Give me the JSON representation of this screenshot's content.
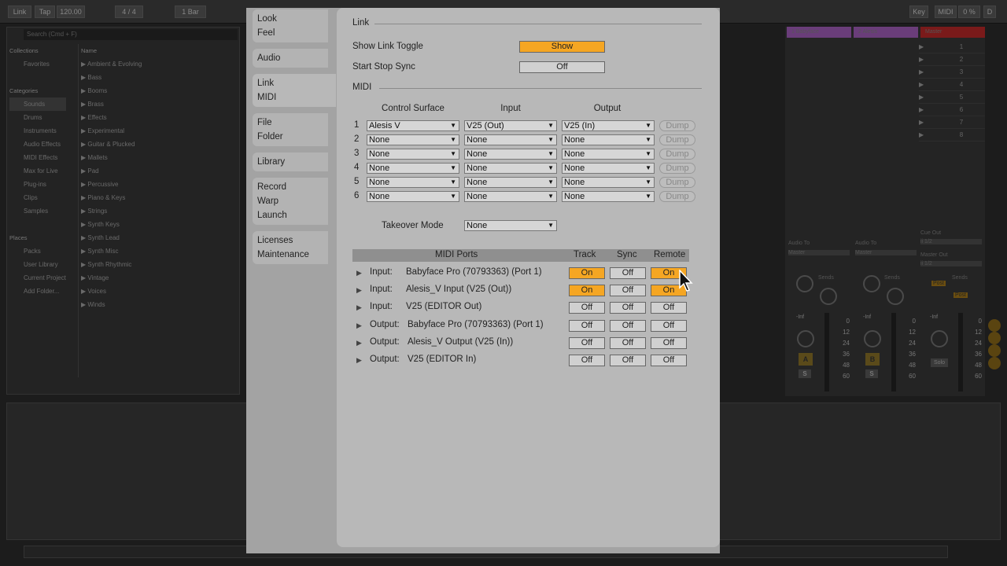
{
  "background": {
    "topbar": [
      "Link",
      "Tap",
      "120.00",
      "4 / 4",
      "1 Bar",
      "Key",
      "MIDI",
      "0 %",
      "D"
    ],
    "search_placeholder": "Search (Cmd + F)",
    "collections_header": "Collections",
    "favorites": "Favorites",
    "categories_header": "Categories",
    "categories": [
      "Sounds",
      "Drums",
      "Instruments",
      "Audio Effects",
      "MIDI Effects",
      "Max for Live",
      "Plug-ins",
      "Clips",
      "Samples"
    ],
    "places_header": "Places",
    "places": [
      "Packs",
      "User Library",
      "Current Project",
      "Add Folder..."
    ],
    "name_header": "Name",
    "names": [
      "Ambient & Evolving",
      "Bass",
      "Booms",
      "Brass",
      "Effects",
      "Experimental",
      "Guitar & Plucked",
      "Mallets",
      "Pad",
      "Percussive",
      "Piano & Keys",
      "Strings",
      "Synth Keys",
      "Synth Lead",
      "Synth Misc",
      "Synth Rhythmic",
      "Vintage",
      "Voices",
      "Winds"
    ],
    "tracks": [
      "1 Babyface",
      "2 Alesis",
      "Master"
    ],
    "clip_numbers": [
      "1",
      "2",
      "3",
      "4",
      "5",
      "6",
      "7",
      "8"
    ],
    "audio_to": "Audio To",
    "master": "Master",
    "cue_out": "Cue Out",
    "cue_val": "ii 1/2",
    "master_out": "Master Out",
    "sends": "Sends",
    "post": "Post",
    "inf": "-Inf",
    "db_scale": [
      "0",
      "12",
      "24",
      "36",
      "48",
      "60"
    ],
    "track_a": "A",
    "track_b": "B",
    "solo": "S",
    "solo_label": "Solo"
  },
  "prefs": {
    "tabs": [
      {
        "line1": "Look",
        "line2": "Feel"
      },
      {
        "line1": "Audio"
      },
      {
        "line1": "Link",
        "line2": "MIDI"
      },
      {
        "line1": "File",
        "line2": "Folder"
      },
      {
        "line1": "Library"
      },
      {
        "line1": "Record",
        "line2": "Warp",
        "line3": "Launch"
      },
      {
        "line1": "Licenses",
        "line2": "Maintenance"
      }
    ],
    "link": {
      "title": "Link",
      "show_toggle_label": "Show Link Toggle",
      "show_toggle_value": "Show",
      "start_stop_label": "Start Stop Sync",
      "start_stop_value": "Off"
    },
    "midi": {
      "title": "MIDI",
      "col_control_surface": "Control Surface",
      "col_input": "Input",
      "col_output": "Output",
      "dump_label": "Dump",
      "rows": [
        {
          "num": "1",
          "surface": "Alesis V",
          "input": "V25 (Out)",
          "output": "V25 (In)"
        },
        {
          "num": "2",
          "surface": "None",
          "input": "None",
          "output": "None"
        },
        {
          "num": "3",
          "surface": "None",
          "input": "None",
          "output": "None"
        },
        {
          "num": "4",
          "surface": "None",
          "input": "None",
          "output": "None"
        },
        {
          "num": "5",
          "surface": "None",
          "input": "None",
          "output": "None"
        },
        {
          "num": "6",
          "surface": "None",
          "input": "None",
          "output": "None"
        }
      ],
      "takeover_label": "Takeover Mode",
      "takeover_value": "None"
    },
    "ports": {
      "header_ports": "MIDI Ports",
      "header_track": "Track",
      "header_sync": "Sync",
      "header_remote": "Remote",
      "rows": [
        {
          "dir": "Input:",
          "name": "Babyface Pro (70793363) (Port 1)",
          "track": "On",
          "sync": "Off",
          "remote": "On"
        },
        {
          "dir": "Input:",
          "name": "Alesis_V Input (V25 (Out))",
          "track": "On",
          "sync": "Off",
          "remote": "On"
        },
        {
          "dir": "Input:",
          "name": "V25 (EDITOR Out)",
          "track": "Off",
          "sync": "Off",
          "remote": "Off"
        },
        {
          "dir": "Output:",
          "name": "Babyface Pro (70793363) (Port 1)",
          "track": "Off",
          "sync": "Off",
          "remote": "Off"
        },
        {
          "dir": "Output:",
          "name": "Alesis_V Output (V25 (In))",
          "track": "Off",
          "sync": "Off",
          "remote": "Off"
        },
        {
          "dir": "Output:",
          "name": "V25 (EDITOR In)",
          "track": "Off",
          "sync": "Off",
          "remote": "Off"
        }
      ]
    }
  },
  "colors": {
    "on": "#f5a623",
    "off": "#d0d0d0",
    "panel": "#b8b8b8"
  }
}
